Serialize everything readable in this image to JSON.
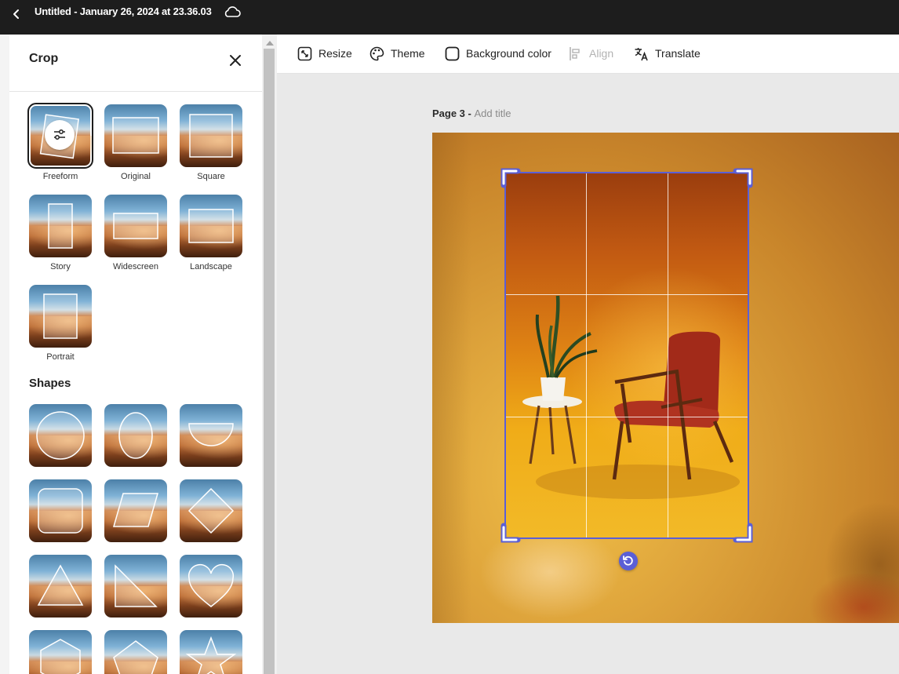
{
  "header": {
    "title": "Untitled - January 26, 2024 at 23.36.03"
  },
  "panel": {
    "title": "Crop",
    "presets": [
      {
        "label": "Freeform"
      },
      {
        "label": "Original"
      },
      {
        "label": "Square"
      },
      {
        "label": "Story"
      },
      {
        "label": "Widescreen"
      },
      {
        "label": "Landscape"
      },
      {
        "label": "Portrait"
      }
    ],
    "shapes_heading": "Shapes",
    "shapes": [
      "circle",
      "ellipse",
      "half-circle",
      "rounded-square",
      "parallelogram",
      "diamond",
      "triangle",
      "right-triangle",
      "heart",
      "hexagon",
      "pentagon",
      "star"
    ]
  },
  "toolbar": {
    "resize": "Resize",
    "theme": "Theme",
    "background_color": "Background color",
    "align": "Align",
    "translate": "Translate"
  },
  "canvas": {
    "page_label": "Page 3 - ",
    "add_title": "Add title"
  },
  "colors": {
    "accent": "#5b5fd6",
    "titlebar": "#1d1d1d"
  }
}
